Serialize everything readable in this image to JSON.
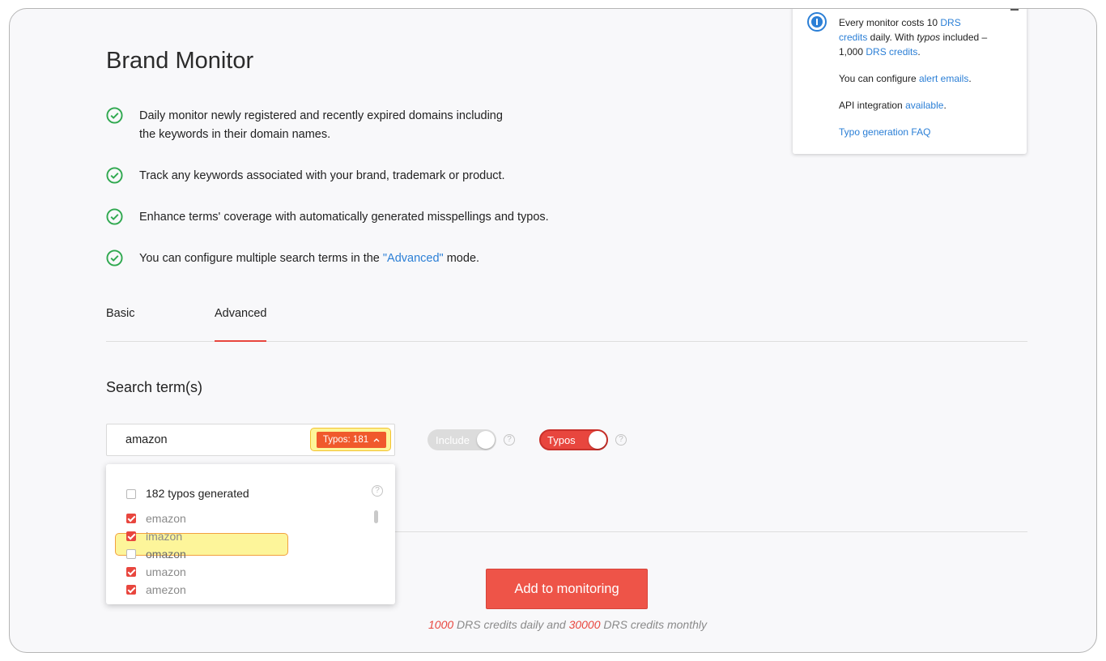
{
  "page": {
    "title": "Brand Monitor"
  },
  "features": [
    {
      "text_line1": "Daily monitor newly registered and recently expired domains including",
      "text_line2": "the keywords in their domain names."
    },
    {
      "text": "Track any keywords associated with your brand, trademark or product."
    },
    {
      "text": "Enhance terms' coverage with automatically generated misspellings and typos."
    },
    {
      "text_before": "You can configure multiple search terms in the ",
      "link": "\"Advanced\"",
      "text_after": " mode."
    }
  ],
  "tabs": {
    "basic": "Basic",
    "advanced": "Advanced",
    "active": "Advanced"
  },
  "search": {
    "section_title": "Search term(s)",
    "term_value": "amazon",
    "typos_badge": "Typos: 181",
    "include_toggle": "Include",
    "typos_toggle": "Typos",
    "help_glyph": "?"
  },
  "dropdown": {
    "header": "182 typos generated",
    "items": [
      {
        "label": "emazon",
        "checked": true
      },
      {
        "label": "imazon",
        "checked": true
      },
      {
        "label": "omazon",
        "checked": false
      },
      {
        "label": "umazon",
        "checked": true
      },
      {
        "label": "amezon",
        "checked": true
      }
    ]
  },
  "actions": {
    "add_button": "Add to monitoring",
    "credits_daily": "1000",
    "credits_mid": " DRS credits daily and ",
    "credits_monthly": "30000",
    "credits_end": " DRS credits monthly"
  },
  "info_card": {
    "line1_before": "Every monitor costs 10 ",
    "line1_link": "DRS",
    "line2_link": "credits",
    "line2_after": " daily. With ",
    "line2_em": "typos",
    "line2_end": " included –",
    "line3_before": "1,000 ",
    "line3_link": "DRS credits",
    "line3_after": ".",
    "alerts_before": "You can configure ",
    "alerts_link": "alert emails",
    "alerts_after": ".",
    "api_before": "API integration ",
    "api_link": "available",
    "api_after": ".",
    "faq_link": "Typo generation FAQ"
  },
  "colors": {
    "accent": "#e8463e",
    "link": "#2b7fd6",
    "highlight": "#fdf59a",
    "check": "#2fa84f"
  }
}
